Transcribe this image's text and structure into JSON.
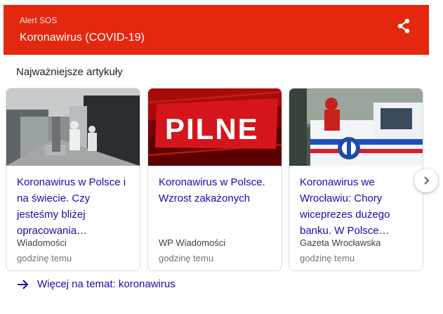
{
  "header": {
    "label": "Alert SOS",
    "title": "Koronawirus (COVID-19)",
    "share_icon": "share-icon",
    "background_color": "#e3280f"
  },
  "section": {
    "title": "Najważniejsze artykuły"
  },
  "articles": [
    {
      "title": "Koronawirus w Polsce i na świecie. Czy jesteśmy bliżej opracowania…",
      "source": "Wiadomości",
      "time": "godzinę temu",
      "image": "hospital-corridor-photo"
    },
    {
      "title": "Koronawirus w Polsce. Wzrost zakażonych",
      "source": "WP Wiadomości",
      "time": "godzinę temu",
      "image": "pilne-banner",
      "image_text": "PILNE"
    },
    {
      "title": "Koronawirus we Wrocławiu: Chory wiceprezes dużego banku. W Polsce…",
      "source": "Gazeta Wrocławska",
      "time": "godzinę temu",
      "image": "ambulance-photo"
    }
  ],
  "carousel": {
    "next_icon": "chevron-right-icon"
  },
  "more": {
    "label": "Więcej na temat: koronawirus",
    "icon": "arrow-right-icon",
    "link_color": "#1a0dab"
  }
}
